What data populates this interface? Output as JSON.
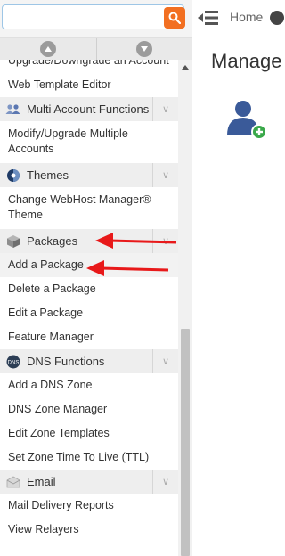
{
  "search": {
    "value": "",
    "placeholder": ""
  },
  "header": {
    "home_label": "Home"
  },
  "sidebar": {
    "items": [
      {
        "type": "item",
        "label": "Upgrade/Downgrade an Account",
        "size": "single"
      },
      {
        "type": "item",
        "label": "Web Template Editor",
        "size": "single"
      },
      {
        "type": "category",
        "label": "Multi Account Functions",
        "icon": "users-icon"
      },
      {
        "type": "item",
        "label": "Modify/Upgrade Multiple Accounts",
        "size": "double"
      },
      {
        "type": "category",
        "label": "Themes",
        "icon": "theme-icon"
      },
      {
        "type": "item",
        "label": "Change WebHost Manager® Theme",
        "size": "double"
      },
      {
        "type": "category",
        "label": "Packages",
        "icon": "package-icon"
      },
      {
        "type": "item",
        "label": "Add a Package",
        "size": "single",
        "active": true
      },
      {
        "type": "item",
        "label": "Delete a Package",
        "size": "single"
      },
      {
        "type": "item",
        "label": "Edit a Package",
        "size": "single"
      },
      {
        "type": "item",
        "label": "Feature Manager",
        "size": "single"
      },
      {
        "type": "category",
        "label": "DNS Functions",
        "icon": "dns-icon"
      },
      {
        "type": "item",
        "label": "Add a DNS Zone",
        "size": "single"
      },
      {
        "type": "item",
        "label": "DNS Zone Manager",
        "size": "single"
      },
      {
        "type": "item",
        "label": "Edit Zone Templates",
        "size": "single"
      },
      {
        "type": "item",
        "label": "Set Zone Time To Live (TTL)",
        "size": "single"
      },
      {
        "type": "category",
        "label": "Email",
        "icon": "email-icon"
      },
      {
        "type": "item",
        "label": "Mail Delivery Reports",
        "size": "single"
      },
      {
        "type": "item",
        "label": "View Relayers",
        "size": "single"
      }
    ]
  },
  "main": {
    "title": "Manage"
  },
  "colors": {
    "accent": "#f26f21",
    "annotation": "#e8191a",
    "category_bg": "#eeeeee",
    "icon_blue": "#3a5a99",
    "icon_green": "#3aa84a"
  }
}
